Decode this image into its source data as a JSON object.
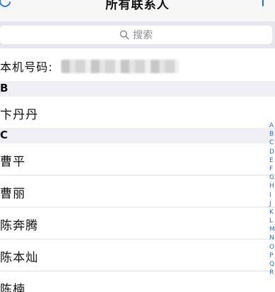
{
  "navbar": {
    "title": "所有联系人",
    "refresh_icon": "refresh-icon",
    "add_icon": "plus-icon",
    "accent_color": "#1a73e8"
  },
  "search": {
    "placeholder": "搜索",
    "icon": "search-icon"
  },
  "my_number": {
    "label": "本机号码:"
  },
  "sections": [
    {
      "letter": "B",
      "contacts": [
        "卞丹丹"
      ]
    },
    {
      "letter": "C",
      "contacts": [
        "曹平",
        "曹丽",
        "陈奔腾",
        "陈本灿",
        "陈楠"
      ]
    }
  ],
  "index_letters": [
    "A",
    "B",
    "C",
    "D",
    "E",
    "F",
    "G",
    "H",
    "I",
    "J",
    "K",
    "L",
    "M",
    "N",
    "O",
    "P",
    "Q",
    "R"
  ]
}
